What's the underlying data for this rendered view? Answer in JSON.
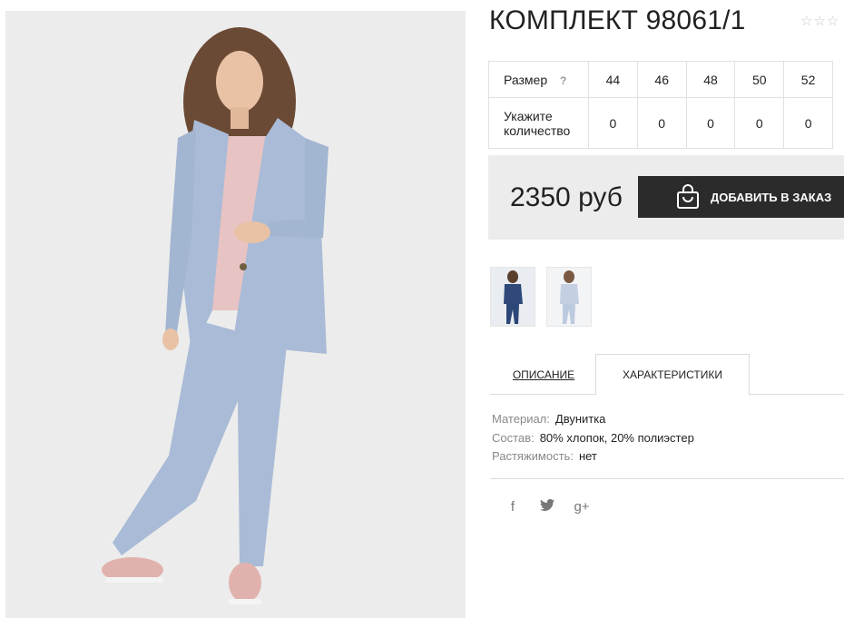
{
  "product": {
    "title": "КОМПЛЕКТ 98061/1",
    "rating": "☆☆☆",
    "price": "2350 руб",
    "order_button": "ДОБАВИТЬ В ЗАКАЗ"
  },
  "size_table": {
    "size_label": "Размер",
    "help": "?",
    "sizes": [
      "44",
      "46",
      "48",
      "50",
      "52"
    ],
    "qty_label": "Укажите количество",
    "quantities": [
      "0",
      "0",
      "0",
      "0",
      "0"
    ]
  },
  "tabs": [
    {
      "label": "ОПИСАНИЕ"
    },
    {
      "label": "ХАРАКТЕРИСТИКИ"
    }
  ],
  "specs": [
    {
      "key": "Материал:",
      "value": "Двунитка"
    },
    {
      "key": "Состав:",
      "value": "80% хлопок, 20% полиэстер"
    },
    {
      "key": "Растяжимость:",
      "value": "нет"
    }
  ],
  "social": {
    "facebook": "f",
    "twitter": "🐦",
    "googleplus": "g+"
  },
  "colors": {
    "accent_dark": "#2b2b2b",
    "suit_blue": "#a9bbd6",
    "panel_grey": "#ececec"
  }
}
